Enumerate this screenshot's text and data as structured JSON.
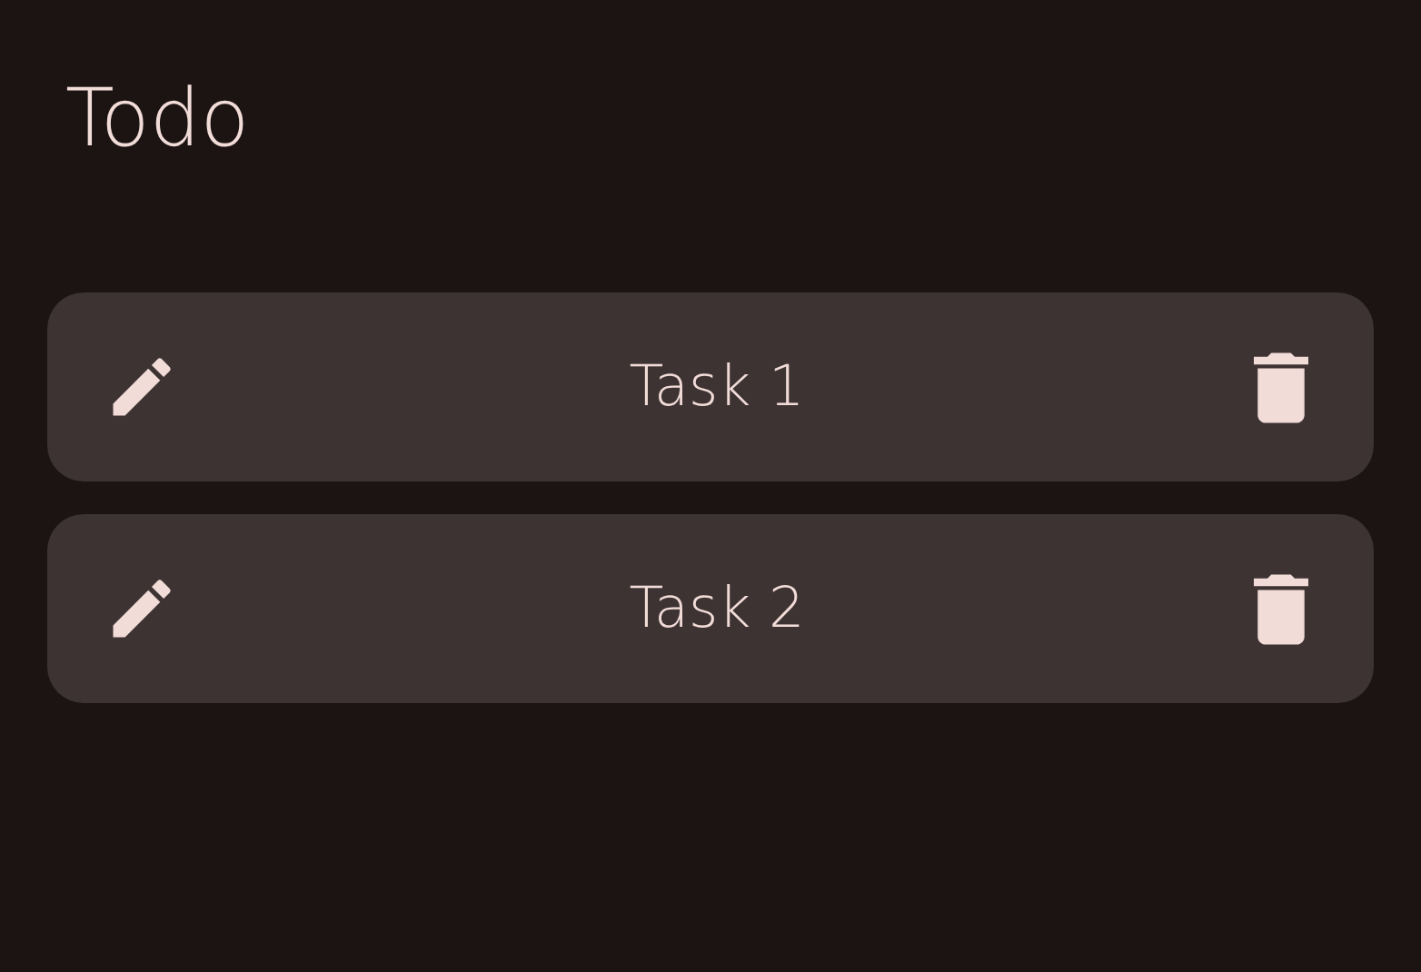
{
  "app_bar": {
    "title": "Todo"
  },
  "tasks": [
    {
      "title": "Task 1"
    },
    {
      "title": "Task 2"
    }
  ]
}
